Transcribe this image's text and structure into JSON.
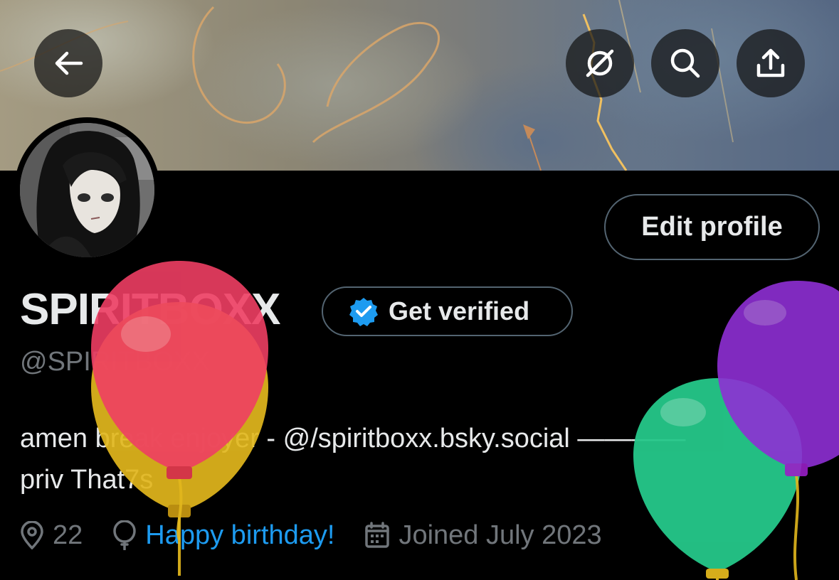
{
  "profile": {
    "display_name": "SPIRITBOXX",
    "handle": "@SPIRITBOXX",
    "bio_line_1": "amen break enjoyer - @/spiritboxx.bsky.social ————",
    "bio_line_2": "priv That7s",
    "location": "22",
    "birthday_text": "Happy birthday!",
    "joined": "Joined July 2023"
  },
  "actions": {
    "edit_profile_label": "Edit profile",
    "get_verified_label": "Get verified"
  },
  "header_icons": [
    "back-arrow-icon",
    "grok-icon",
    "search-icon",
    "share-icon"
  ],
  "colors": {
    "background": "#000000",
    "text_primary": "#e7e9ea",
    "text_secondary": "#71767b",
    "link": "#1d9bf0",
    "verified_badge": "#1d9bf0",
    "border": "#536471",
    "balloon_red": "#ee4466",
    "balloon_yellow": "#e2b71d",
    "balloon_green": "#2fcf93",
    "balloon_purple": "#9b3ed8"
  }
}
